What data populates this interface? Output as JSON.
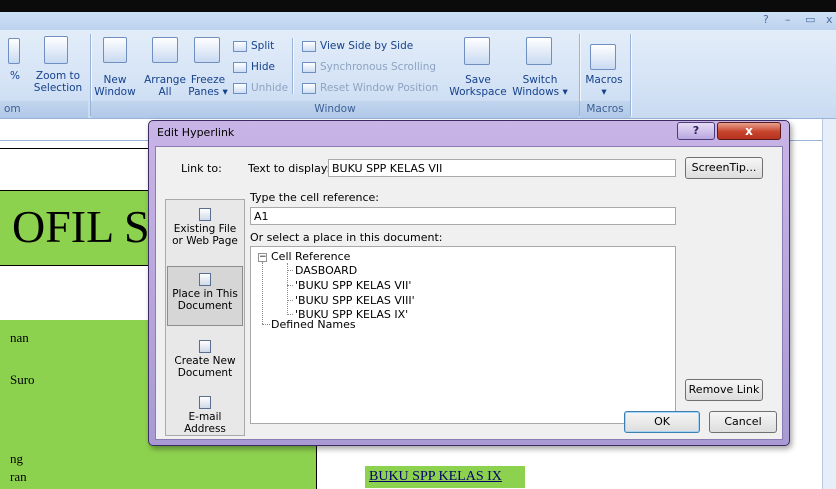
{
  "window": {
    "controls": [
      "?",
      "–",
      "▭",
      "x"
    ]
  },
  "ribbon": {
    "zoom_group": {
      "pct_label": "%",
      "zoom_to_selection": [
        "Zoom to",
        "Selection"
      ],
      "group_label_partial": "om"
    },
    "window_group": {
      "new_window": [
        "New",
        "Window"
      ],
      "arrange_all": [
        "Arrange",
        "All"
      ],
      "freeze_panes": [
        "Freeze",
        "Panes"
      ],
      "split": "Split",
      "hide": "Hide",
      "unhide": "Unhide",
      "view_side_by_side": "View Side by Side",
      "synchronous_scrolling": "Synchronous Scrolling",
      "reset_window_position": "Reset Window Position",
      "save_workspace": [
        "Save",
        "Workspace"
      ],
      "switch_windows": [
        "Switch",
        "Windows"
      ],
      "group_label": "Window"
    },
    "macros_group": {
      "macros": "Macros",
      "group_label": "Macros"
    }
  },
  "sheet": {
    "big_text": "OFIL S",
    "left_texts": [
      "nan",
      "Suro",
      "ng",
      "ran"
    ],
    "link_text": "BUKU SPP KELAS IX"
  },
  "dialog": {
    "title": "Edit Hyperlink",
    "link_to_label": "Link to:",
    "text_to_display_label": "Text to display:",
    "text_to_display_value": "BUKU SPP KELAS VII",
    "screentip_button": "ScreenTip...",
    "cell_ref_label": "Type the cell reference:",
    "cell_ref_value": "A1",
    "select_place_label": "Or select a place in this document:",
    "link_to_items": [
      {
        "label": "Existing File or Web Page",
        "icon": "existing-file-icon"
      },
      {
        "label": "Place in This Document",
        "icon": "place-in-document-icon"
      },
      {
        "label": "Create New Document",
        "icon": "new-document-icon"
      },
      {
        "label": "E-mail Address",
        "icon": "email-icon"
      }
    ],
    "tree": {
      "root": "Cell Reference",
      "children": [
        "DASBOARD",
        "'BUKU SPP KELAS VII'",
        "'BUKU SPP KELAS VIII'",
        "'BUKU SPP KELAS IX'"
      ],
      "defined_names": "Defined Names"
    },
    "remove_link_button": "Remove Link",
    "ok_button": "OK",
    "cancel_button": "Cancel",
    "help_button": "?",
    "close_button": "x"
  }
}
